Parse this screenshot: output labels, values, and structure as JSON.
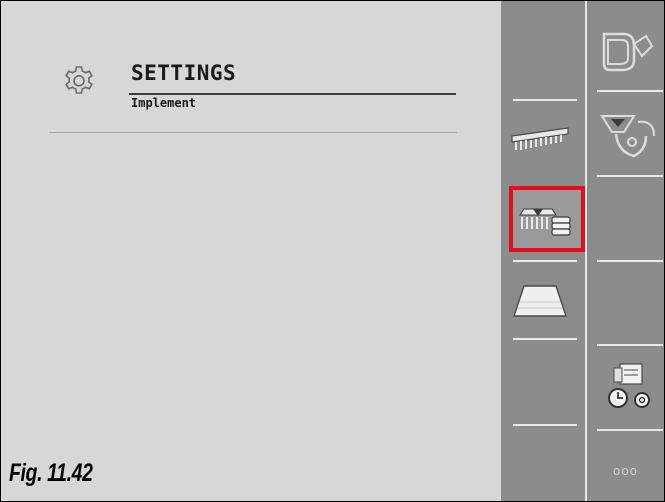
{
  "header": {
    "title": "SETTINGS",
    "subtitle": "Implement",
    "icon": "gear-icon"
  },
  "figure_caption": "Fig. 11.42",
  "softkeys": {
    "left_column": [
      {
        "name": "empty",
        "icon": ""
      },
      {
        "name": "implement-boom",
        "icon": "boom-icon"
      },
      {
        "name": "implement-data",
        "icon": "implement-data-icon",
        "selected": true
      },
      {
        "name": "working-width",
        "icon": "trapezoid-icon"
      },
      {
        "name": "empty",
        "icon": ""
      },
      {
        "name": "empty",
        "icon": ""
      }
    ],
    "right_column": [
      {
        "name": "spreader-settings",
        "icon": "spreader-icon"
      },
      {
        "name": "hopper-settings",
        "icon": "hopper-icon"
      },
      {
        "name": "empty",
        "icon": ""
      },
      {
        "name": "empty",
        "icon": ""
      },
      {
        "name": "time-settings",
        "icon": "time-gear-icon"
      },
      {
        "name": "more",
        "icon": "more-icon",
        "label": "ooo"
      }
    ]
  },
  "colors": {
    "highlight": "#e0101e",
    "softkey_bg": "#8c8c8c",
    "main_bg": "#d7d7d7"
  }
}
